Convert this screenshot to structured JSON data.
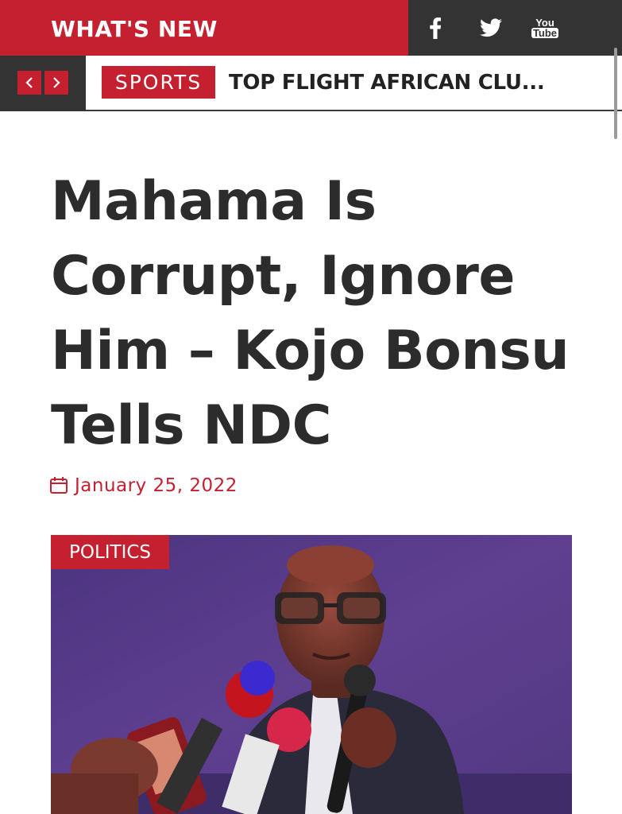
{
  "header": {
    "section_label": "WHAT'S NEW",
    "social": [
      {
        "icon": "facebook-icon",
        "label": "f"
      },
      {
        "icon": "twitter-icon",
        "label": ""
      },
      {
        "icon": "youtube-icon",
        "label_top": "You",
        "label_bottom": "Tube"
      }
    ]
  },
  "ticker": {
    "prev_icon": "chevron-left-icon",
    "next_icon": "chevron-right-icon",
    "category": "SPORTS",
    "headline": "TOP FLIGHT AFRICAN CLU..."
  },
  "article": {
    "title": "Mahama Is Corrupt, Ignore Him – Kojo Bonsu Tells NDC",
    "date_icon": "calendar-icon",
    "date": "January 25, 2022",
    "category": "POLITICS"
  },
  "colors": {
    "accent": "#c5202f",
    "dark": "#333333",
    "title_text": "#2c2c2c",
    "hero_background": "#5a3a86"
  }
}
